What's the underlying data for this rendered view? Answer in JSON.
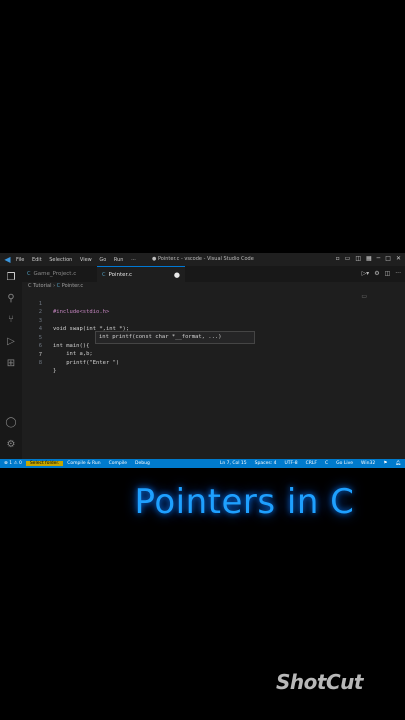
{
  "window": {
    "title": "● Pointer.c - vscode - Visual Studio Code",
    "menu": [
      "File",
      "Edit",
      "Selection",
      "View",
      "Go",
      "Run",
      "···"
    ]
  },
  "tabs": [
    {
      "label": "Game_Project.c",
      "icon": "c-file-icon",
      "active": false
    },
    {
      "label": "Pointer.c",
      "icon": "c-file-icon",
      "active": true,
      "modified": true
    }
  ],
  "breadcrumb": [
    "C Tutorial",
    "Pointer.c"
  ],
  "editor": {
    "lines": [
      {
        "n": "1",
        "text": "#include<stdio.h>"
      },
      {
        "n": "2",
        "text": ""
      },
      {
        "n": "3",
        "text": "void swap(int *,int *);"
      },
      {
        "n": "4",
        "text": ""
      },
      {
        "n": "5",
        "text": "int main(){"
      },
      {
        "n": "6",
        "text": "    int a,b;"
      },
      {
        "n": "7",
        "text": "    printf(\"Enter \")"
      },
      {
        "n": "8",
        "text": "}"
      }
    ],
    "tooltip": "int printf(const char *__format, ...)"
  },
  "statusbar": {
    "errors": "⊗ 1 ⚠ 0",
    "folder": "Select folder.",
    "compile_run": "Compile & Run",
    "compile": "Compile",
    "debug": "Debug",
    "position": "Ln 7, Col 15",
    "spaces": "Spaces: 4",
    "encoding": "UTF-8",
    "eol": "CRLF",
    "language": "C",
    "golive": "Go Live",
    "platform": "Win32"
  },
  "overlay": {
    "title": "Pointers in C",
    "watermark": "ShotCut"
  },
  "colors": {
    "accent": "#007acc",
    "title_glow": "#1ea0ff"
  }
}
